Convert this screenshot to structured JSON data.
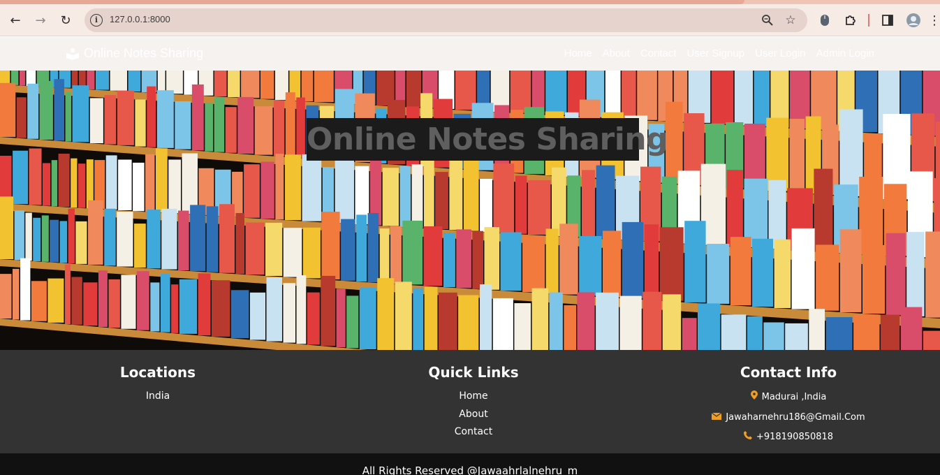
{
  "browser": {
    "url": "127.0.0.1:8000",
    "icons": [
      "back-icon",
      "forward-icon",
      "reload-icon",
      "site-info-icon",
      "zoom-icon",
      "bookmark-star-icon",
      "extension-mouse-icon",
      "extensions-puzzle-icon",
      "side-panel-icon",
      "profile-avatar-icon",
      "menu-icon"
    ]
  },
  "nav": {
    "brand": "Online Notes Sharing",
    "links": [
      "Home",
      "About",
      "Contact",
      "User Signup",
      "User Login",
      "Admin Login"
    ]
  },
  "hero": {
    "title": "Online Notes Sharing"
  },
  "footer": {
    "locations": {
      "heading": "Locations",
      "items": [
        "India"
      ]
    },
    "quick_links": {
      "heading": "Quick Links",
      "items": [
        "Home",
        "About",
        "Contact"
      ]
    },
    "contact": {
      "heading": "Contact Info",
      "address": "Madurai ,India",
      "email": "Jawaharnehru186@Gmail.Com",
      "phone": "+918190850818"
    },
    "copyright": "All Rights Reserved @Jawaahrlalnehru_m"
  },
  "colors": {
    "accent_icon": "#f0a020",
    "footer_bg": "#333333",
    "bottom_bg": "#111111"
  }
}
